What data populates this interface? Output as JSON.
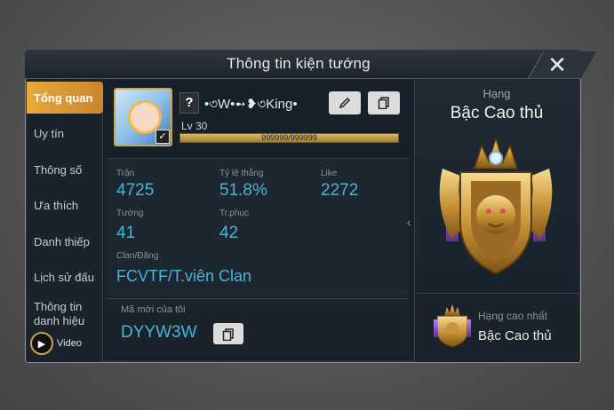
{
  "window": {
    "title": "Thông tin kiện tướng",
    "close_glyph": "✕"
  },
  "sidebar": {
    "items": [
      {
        "label": "Tổng quan",
        "active": true
      },
      {
        "label": "Uy tín",
        "active": false
      },
      {
        "label": "Thông số",
        "active": false
      },
      {
        "label": "Ưa thích",
        "active": false
      },
      {
        "label": "Danh thiếp",
        "active": false
      },
      {
        "label": "Lịch sử đấu",
        "active": false
      },
      {
        "label": "Thông tin danh hiệu",
        "active": false
      }
    ],
    "video_label": "Video"
  },
  "profile": {
    "badge": "?",
    "name": "•৩W•➻❥৩King•",
    "level": "Lv 30",
    "xp_text": "999999/999999",
    "xp_fraction": 1.0,
    "edit_icon": "pencil-icon",
    "copy_icon": "copy-icon"
  },
  "stats": {
    "matches_label": "Trận",
    "matches_value": "4725",
    "winrate_label": "Tỷ lệ thắng",
    "winrate_value": "51.8%",
    "like_label": "Like",
    "like_value": "2272",
    "heroes_label": "Tướng",
    "heroes_value": "41",
    "skins_label": "Tr.phục",
    "skins_value": "42",
    "clan_label": "Clan/Đăng",
    "clan_value": "FCVTF/T.viên Clan"
  },
  "invite": {
    "label": "Mã mời của tôi",
    "code": "DYYW3W"
  },
  "rank": {
    "label": "Hạng",
    "name": "Bậc Cao thủ",
    "best_label": "Hạng cao nhất",
    "best_name": "Bậc Cao thủ"
  },
  "colors": {
    "accent": "#e9a93a",
    "stat_value": "#4ab4d8",
    "panel_bg": "#16202a"
  }
}
